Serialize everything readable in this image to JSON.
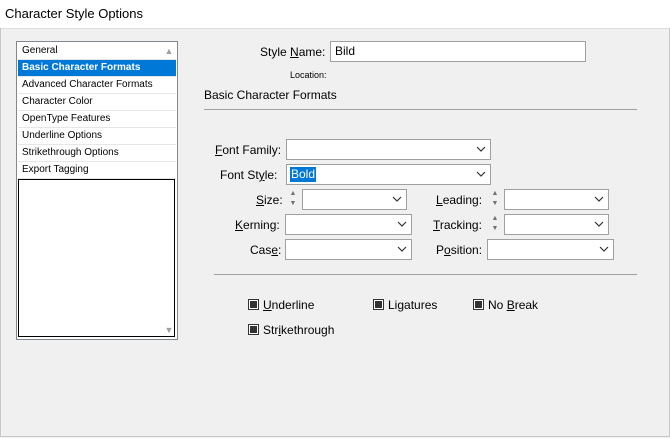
{
  "window": {
    "title": "Character Style Options"
  },
  "categories": [
    {
      "label": "General",
      "selected": false
    },
    {
      "label": "Basic Character Formats",
      "selected": true
    },
    {
      "label": "Advanced Character Formats",
      "selected": false
    },
    {
      "label": "Character Color",
      "selected": false
    },
    {
      "label": "OpenType Features",
      "selected": false
    },
    {
      "label": "Underline Options",
      "selected": false
    },
    {
      "label": "Strikethrough Options",
      "selected": false
    },
    {
      "label": "Export Tagging",
      "selected": false
    }
  ],
  "style_name": {
    "label_pre": "Style ",
    "label_u": "N",
    "label_post": "ame:",
    "value": "Bild"
  },
  "location": {
    "label": "Location:"
  },
  "section": {
    "title": "Basic Character Formats"
  },
  "fields": {
    "font_family": {
      "label_u": "F",
      "label_post": "ont Family:",
      "value": ""
    },
    "font_style": {
      "label_pre": "Font St",
      "label_u": "y",
      "label_post": "le:",
      "value": "Bold"
    },
    "size": {
      "label_u": "S",
      "label_post": "ize:",
      "value": ""
    },
    "leading": {
      "label_u": "L",
      "label_post": "eading:",
      "value": ""
    },
    "kerning": {
      "label_u": "K",
      "label_post": "erning:",
      "value": ""
    },
    "tracking": {
      "label_u": "T",
      "label_post": "racking:",
      "value": ""
    },
    "case": {
      "label_pre": "Cas",
      "label_u": "e",
      "label_post": ":",
      "value": ""
    },
    "position": {
      "label_pre": "P",
      "label_u": "o",
      "label_post": "sition:",
      "value": ""
    }
  },
  "checkboxes": {
    "underline": {
      "label_u": "U",
      "label_post": "nderline",
      "checked": true
    },
    "ligatures": {
      "label_pre": "Li",
      "label_u": "g",
      "label_post": "atures",
      "checked": true
    },
    "no_break": {
      "label_pre": "No ",
      "label_u": "B",
      "label_post": "reak",
      "checked": true
    },
    "strikethrough": {
      "label_pre": "Str",
      "label_u": "i",
      "label_post": "kethrough",
      "checked": true
    }
  },
  "colors": {
    "selection": "#0078d7",
    "background": "#f0f0f0"
  }
}
